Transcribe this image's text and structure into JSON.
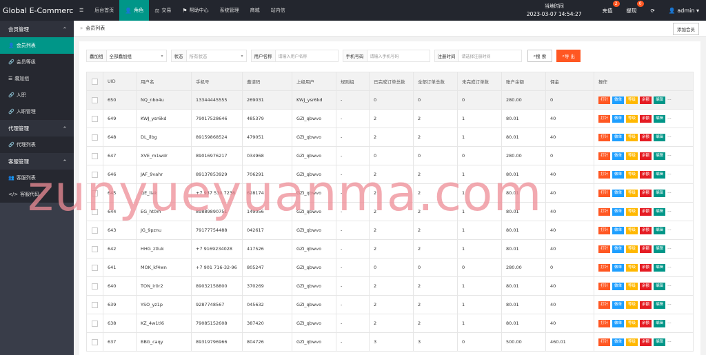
{
  "brand": "Global E-Commerce...",
  "nav": [
    {
      "label": "后台首页",
      "icon": ""
    },
    {
      "label": "角色",
      "icon": "👤"
    },
    {
      "label": "交易",
      "icon": "⚖"
    },
    {
      "label": "帮助中心",
      "icon": "⚑"
    },
    {
      "label": "系统管理",
      "icon": ""
    },
    {
      "label": "商城",
      "icon": ""
    },
    {
      "label": "站内信",
      "icon": ""
    }
  ],
  "clock": {
    "label": "当地时间",
    "value": "2023-03-07 14:54:27"
  },
  "topright": {
    "recharge": "充值",
    "recharge_badge": "2",
    "withdraw": "提现",
    "withdraw_badge": "0",
    "user": "admin"
  },
  "sidebar": {
    "groups": [
      {
        "label": "会员管理",
        "items": [
          "会员列表",
          "会员等级",
          "蠢加组",
          "入职",
          "入职管理"
        ]
      },
      {
        "label": "代理管理",
        "items": [
          "代理列表"
        ]
      },
      {
        "label": "客服管理",
        "items": [
          "客服列表",
          "客服代码"
        ]
      }
    ]
  },
  "breadcrumb": "会员列表",
  "add_member": "添加会员",
  "filters": {
    "group_label": "蠢加组",
    "group_value": "全部蠢加组",
    "status_label": "状态",
    "status_placeholder": "所有状态",
    "username_label": "用户名称",
    "username_placeholder": "请输入用户名称",
    "phone_label": "手机号码",
    "phone_placeholder": "请输入手机号码",
    "regtime_label": "注册时间",
    "regtime_placeholder": "请选择注册时间",
    "search": "搜 索",
    "export": "导 出"
  },
  "table": {
    "headers": [
      "UID",
      "用户名",
      "手机号",
      "邀请码",
      "上级用户",
      "规则组",
      "已完成订单总数",
      "全部订单总数",
      "未完成订单数",
      "账户余额",
      "佣金",
      "操作"
    ],
    "op_labels": [
      "打针",
      "做单",
      "等级",
      "余额",
      "编辑"
    ],
    "rows": [
      [
        "650",
        "NQ_nbo4u",
        "13344445555",
        "269031",
        "KWJ_ysr6kd",
        "-",
        "0",
        "0",
        "0",
        "280.00",
        "0"
      ],
      [
        "649",
        "KWJ_ysr6kd",
        "79017528646",
        "485379",
        "GZI_qbwvo",
        "-",
        "2",
        "2",
        "1",
        "80.01",
        "40"
      ],
      [
        "648",
        "DL_ilbg",
        "89159868524",
        "479051",
        "GZI_qbwvo",
        "-",
        "2",
        "2",
        "1",
        "80.01",
        "40"
      ],
      [
        "647",
        "XVE_m1wdr",
        "89016976217",
        "034968",
        "GZI_qbwvo",
        "-",
        "0",
        "0",
        "0",
        "280.00",
        "0"
      ],
      [
        "646",
        "JAF_9vahr",
        "89137853929",
        "706291",
        "GZI_qbwvo",
        "-",
        "2",
        "2",
        "1",
        "80.01",
        "40"
      ],
      [
        "645",
        "QE_liak",
        "+7 937 530 7238",
        "628174",
        "GZI_qbwvo",
        "-",
        "2",
        "2",
        "1",
        "80.01",
        "40"
      ],
      [
        "644",
        "EG_ht0m",
        "89889890751",
        "149056",
        "GZI_qbwvo",
        "-",
        "2",
        "2",
        "1",
        "80.01",
        "40"
      ],
      [
        "643",
        "JG_9pznu",
        "79177754488",
        "042617",
        "GZI_qbwvo",
        "-",
        "2",
        "2",
        "1",
        "80.01",
        "40"
      ],
      [
        "642",
        "HHG_ztluk",
        "+7 9169234028",
        "417526",
        "GZI_qbwvo",
        "-",
        "2",
        "2",
        "1",
        "80.01",
        "40"
      ],
      [
        "641",
        "MOK_kf4wn",
        "+7 901 716-32-96",
        "805247",
        "GZI_qbwvo",
        "-",
        "0",
        "0",
        "0",
        "280.00",
        "0"
      ],
      [
        "640",
        "TON_ir0r2",
        "89032158800",
        "370269",
        "GZI_qbwvo",
        "-",
        "2",
        "2",
        "1",
        "80.01",
        "40"
      ],
      [
        "639",
        "YSO_yz1p",
        "9287748567",
        "045632",
        "GZI_qbwvo",
        "-",
        "2",
        "2",
        "1",
        "80.01",
        "40"
      ],
      [
        "638",
        "KZ_4w1tl6",
        "79085152608",
        "387420",
        "GZI_qbwvo",
        "-",
        "2",
        "2",
        "1",
        "80.01",
        "40"
      ],
      [
        "637",
        "BBG_caqy",
        "89319796966",
        "804726",
        "GZI_qbwvo",
        "-",
        "3",
        "3",
        "0",
        "500.00",
        "460.01"
      ]
    ]
  },
  "watermark": "zunyueyuanma.com",
  "colors": {
    "topbar": "#23262e",
    "sidebar": "#393d49",
    "accent": "#009688",
    "orange": "#ff5722",
    "blue": "#1e9fff",
    "amber": "#ffb800",
    "red": "#e51c23"
  }
}
